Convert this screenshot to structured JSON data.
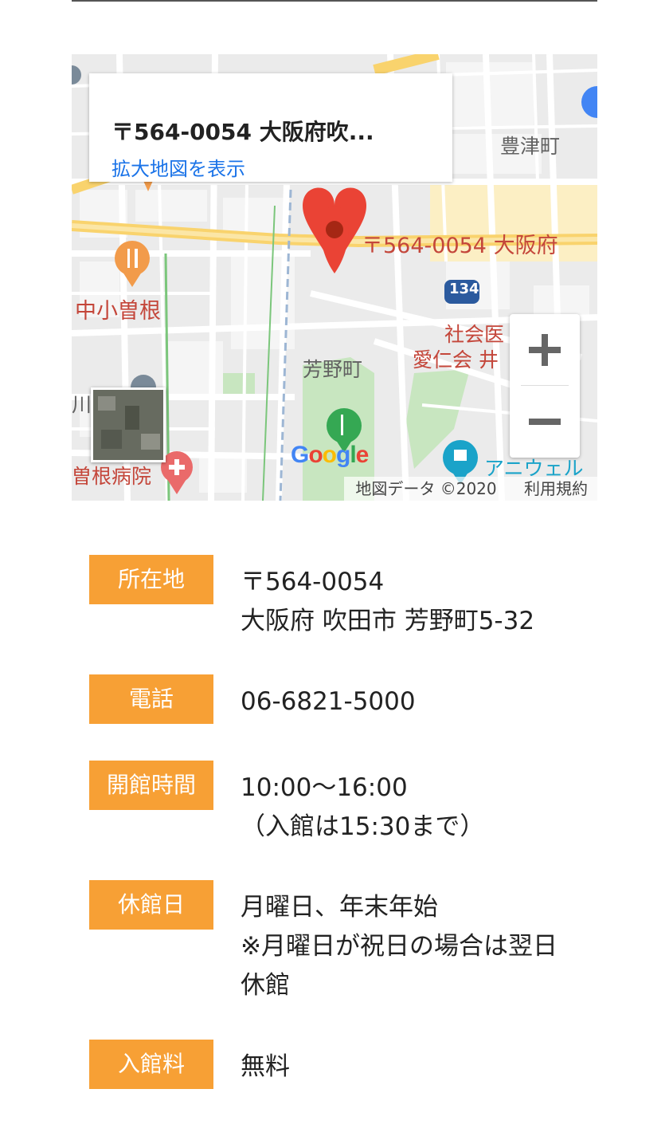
{
  "map": {
    "info_card": {
      "address": "〒564-0054 大阪府吹...",
      "view_larger_link": "拡大地図を表示"
    },
    "marker_label": "〒564-0054 大阪府",
    "labels": {
      "toyotsu": "豊津町",
      "nakakosone": "中小曽根",
      "yoshino": "芳野町",
      "shakai_line1": "社会医　人",
      "shakai_line2": "愛仁会 井　院",
      "sone_hospital": "曽根病院",
      "ani": "アニウェル",
      "kawa": "川",
      "route": "134"
    },
    "google_logo": [
      "G",
      "o",
      "o",
      "g",
      "l",
      "e"
    ],
    "google_colors": [
      "#4285F4",
      "#EA4335",
      "#FBBC05",
      "#4285F4",
      "#34A853",
      "#EA4335"
    ],
    "attribution": {
      "map_data": "地図データ ©2020",
      "terms": "利用規約"
    },
    "zoom": {
      "in_icon": "plus-icon",
      "out_icon": "minus-icon"
    }
  },
  "info": [
    {
      "label": "所在地",
      "value": "〒564-0054\n大阪府 吹田市 芳野町5-32"
    },
    {
      "label": "電話",
      "value": "06-6821-5000"
    },
    {
      "label": "開館時間",
      "value": "10:00〜16:00\n（入館は15:30まで）"
    },
    {
      "label": "休館日",
      "value": "月曜日、年末年始\n※月曜日が祝日の場合は翌日\n休館"
    },
    {
      "label": "入館料",
      "value": "無料"
    }
  ],
  "colors": {
    "label_bg": "#f7a035",
    "link": "#1a73e8",
    "marker": "#ea4335"
  }
}
